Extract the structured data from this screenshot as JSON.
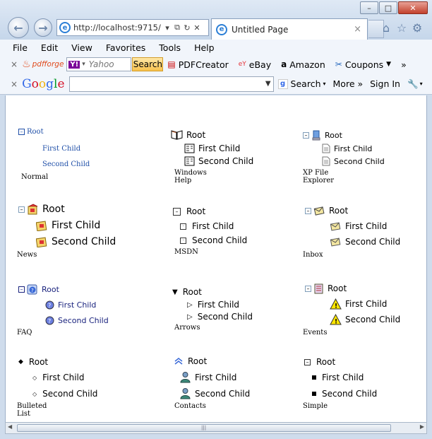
{
  "window": {
    "address": "http://localhost:9715/",
    "tab_title": "Untitled Page",
    "tab_close": "×"
  },
  "menu": [
    "File",
    "Edit",
    "View",
    "Favorites",
    "Tools",
    "Help"
  ],
  "toolbar1": {
    "close": "×",
    "pdfforge": "pdfforge",
    "yahoo_placeholder": "Yahoo",
    "search_button": "Search",
    "pdfcreator": "PDFCreator",
    "ebay": "eBay",
    "amazon": "Amazon",
    "coupons": "Coupons",
    "more": "»"
  },
  "toolbar2": {
    "close": "×",
    "google_logo": [
      "G",
      "o",
      "o",
      "g",
      "l",
      "e"
    ],
    "search": "Search",
    "more": "More »",
    "signin": "Sign In"
  },
  "trees": {
    "normal": {
      "root": "Root",
      "child1": "First Child",
      "child2": "Second Child",
      "caption": "Normal"
    },
    "windows_help": {
      "root": "Root",
      "child1": "First Child",
      "child2": "Second Child",
      "caption": "Windows Help"
    },
    "xp_explorer": {
      "root": "Root",
      "child1": "First Child",
      "child2": "Second Child",
      "caption": "XP File Explorer"
    },
    "news": {
      "root": "Root",
      "child1": "First Child",
      "child2": "Second Child",
      "caption": "News"
    },
    "msdn": {
      "root": "Root",
      "child1": "First Child",
      "child2": "Second Child",
      "caption": "MSDN"
    },
    "inbox": {
      "root": "Root",
      "child1": "First Child",
      "child2": "Second Child",
      "caption": "Inbox"
    },
    "faq": {
      "root": "Root",
      "child1": "First Child",
      "child2": "Second Child",
      "caption": "FAQ"
    },
    "arrows": {
      "root": "Root",
      "child1": "First Child",
      "child2": "Second Child",
      "caption": "Arrows"
    },
    "events": {
      "root": "Root",
      "child1": "First Child",
      "child2": "Second Child",
      "caption": "Events"
    },
    "bulleted": {
      "root": "Root",
      "child1": "First Child",
      "child2": "Second Child",
      "caption": "Bulleted List"
    },
    "contacts": {
      "root": "Root",
      "child1": "First Child",
      "child2": "Second Child",
      "caption": "Contacts"
    },
    "simple": {
      "root": "Root",
      "child1": "First Child",
      "child2": "Second Child",
      "caption": "Simple"
    }
  },
  "colors": {
    "link_blue": "#1f4fa8",
    "navy": "#1a237e",
    "chrome": "#cfdcec"
  }
}
